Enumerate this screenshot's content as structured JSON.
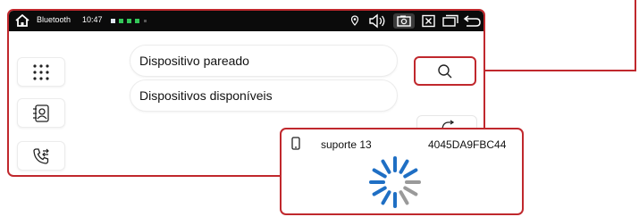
{
  "statusbar": {
    "title": "Bluetooth",
    "time": "10:47",
    "icons": [
      "home-icon",
      "location-icon",
      "volume-icon",
      "screenshot-icon",
      "close-box-icon",
      "window-icon",
      "back-icon"
    ]
  },
  "sidebar": {
    "items": [
      {
        "icon": "dialpad-icon"
      },
      {
        "icon": "contacts-icon"
      },
      {
        "icon": "call-log-icon"
      }
    ]
  },
  "lists": {
    "paired": "Dispositivo pareado",
    "available": "Dispositivos disponíveis"
  },
  "search": {
    "icon": "search-icon"
  },
  "device": {
    "icon": "phone-icon",
    "name": "suporte 13",
    "address": "4045DA9FBC44"
  },
  "colors": {
    "highlight": "#c0282d",
    "statusbar": "#0b0b0b",
    "spinner_blue": "#1f6fc4",
    "spinner_gray": "#9a9a9a"
  }
}
